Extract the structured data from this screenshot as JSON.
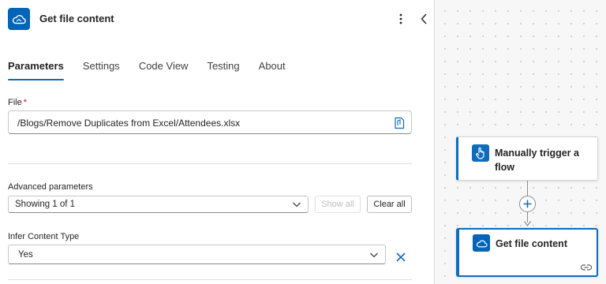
{
  "panel": {
    "title": "Get file content",
    "tabs": [
      {
        "label": "Parameters",
        "active": true
      },
      {
        "label": "Settings",
        "active": false
      },
      {
        "label": "Code View",
        "active": false
      },
      {
        "label": "Testing",
        "active": false
      },
      {
        "label": "About",
        "active": false
      }
    ],
    "file": {
      "label": "File",
      "required_mark": "*",
      "value": "/Blogs/Remove Duplicates from Excel/Attendees.xlsx"
    },
    "advanced": {
      "label": "Advanced parameters",
      "selected": "Showing 1 of 1",
      "show_all": "Show all",
      "clear_all": "Clear all"
    },
    "infer": {
      "label": "Infer Content Type",
      "selected": "Yes"
    }
  },
  "canvas": {
    "nodes": [
      {
        "title_line1": "Manually trigger a",
        "title_line2": "flow",
        "icon": "hand-touch-icon"
      },
      {
        "title": "Get file content",
        "icon": "onedrive-cloud-icon"
      }
    ]
  },
  "colors": {
    "accent": "#0f6cbd",
    "onedrive": "#0364b8",
    "required": "#c50f1f",
    "clear_x": "#0f6cbd"
  }
}
